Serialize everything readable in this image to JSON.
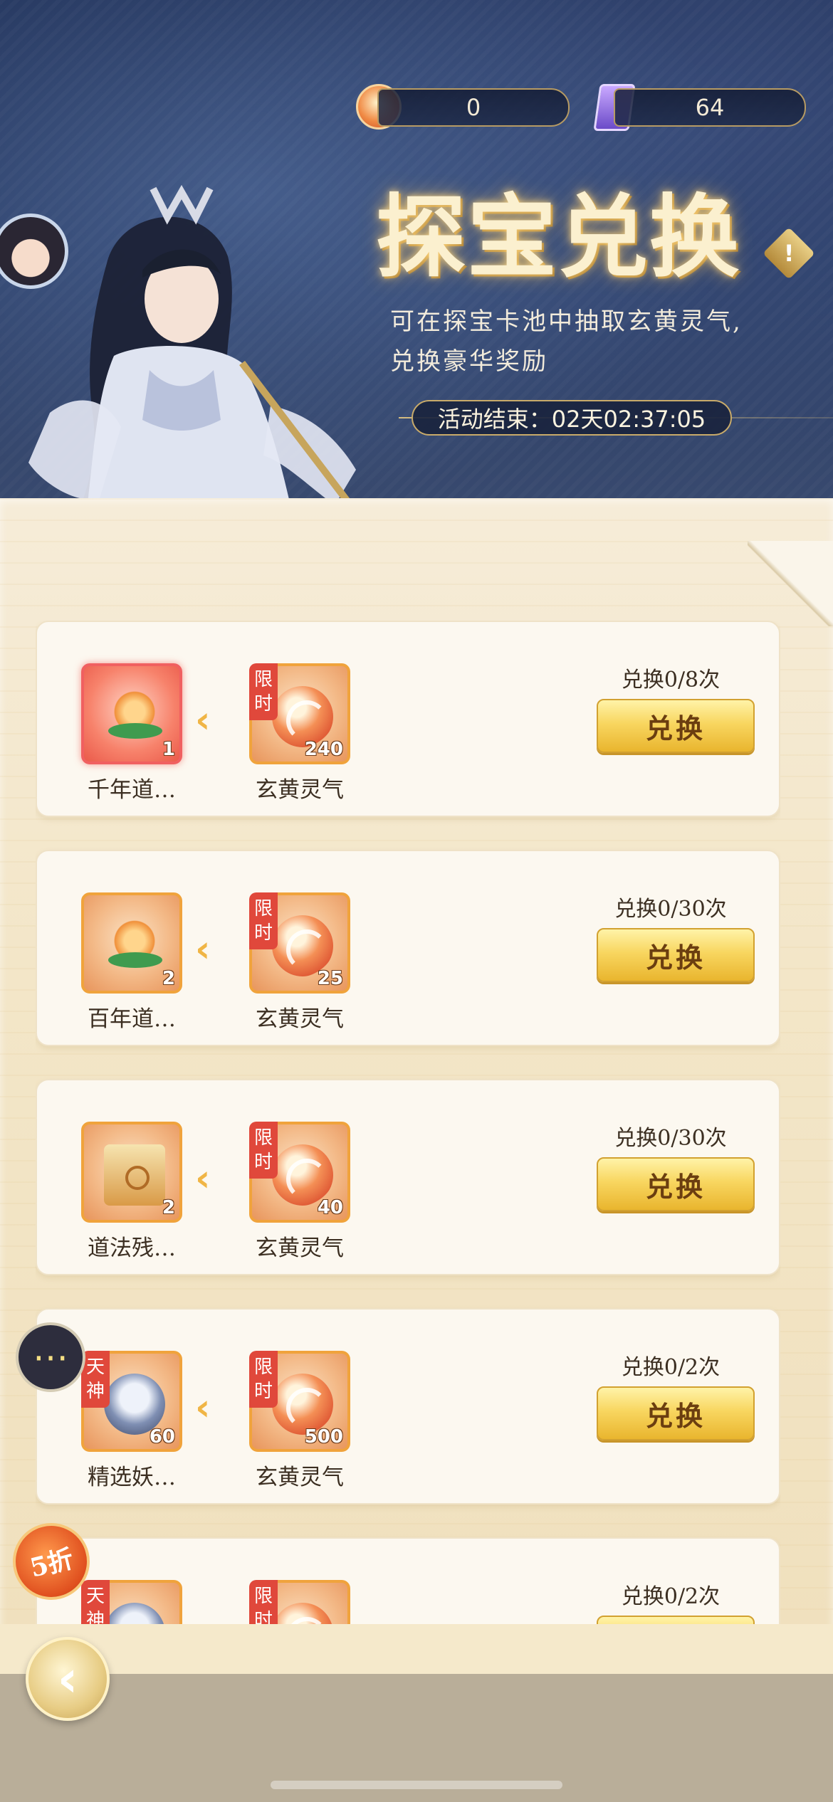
{
  "currency": {
    "coin_icon": "yuanhuang-qi-coin-icon",
    "coin_value": "0",
    "ticket_icon": "ticket-icon",
    "ticket_value": "64"
  },
  "header": {
    "title": "探宝兑换",
    "description_line1": "可在探宝卡池中抽取玄黄灵气,",
    "description_line2": "兑换豪华奖励",
    "timer": "活动结束：02天02:37:05"
  },
  "button_label": "兑换",
  "exchanges": [
    {
      "reward_name": "千年道…",
      "reward_count": "1",
      "reward_icon": "peach-icon",
      "cost_tag": "限时",
      "cost_count": "240",
      "cost_name": "玄黄灵气",
      "limit": "兑换0/8次"
    },
    {
      "reward_name": "百年道…",
      "reward_count": "2",
      "reward_icon": "peach-icon",
      "cost_tag": "限时",
      "cost_count": "25",
      "cost_name": "玄黄灵气",
      "limit": "兑换0/30次"
    },
    {
      "reward_name": "道法残…",
      "reward_count": "2",
      "reward_icon": "scroll-icon",
      "cost_tag": "限时",
      "cost_count": "40",
      "cost_name": "玄黄灵气",
      "limit": "兑换0/30次"
    },
    {
      "reward_name": "精选妖…",
      "reward_count": "60",
      "reward_icon": "portrait-icon",
      "reward_tag": "天神",
      "cost_tag": "限时",
      "cost_count": "500",
      "cost_name": "玄黄灵气",
      "limit": "兑换0/2次"
    },
    {
      "reward_tag": "天神",
      "reward_icon": "portrait-icon",
      "cost_tag": "限时",
      "limit": "兑换0/2次"
    }
  ],
  "discount_badge": "5折",
  "accent": "#f0a33c"
}
